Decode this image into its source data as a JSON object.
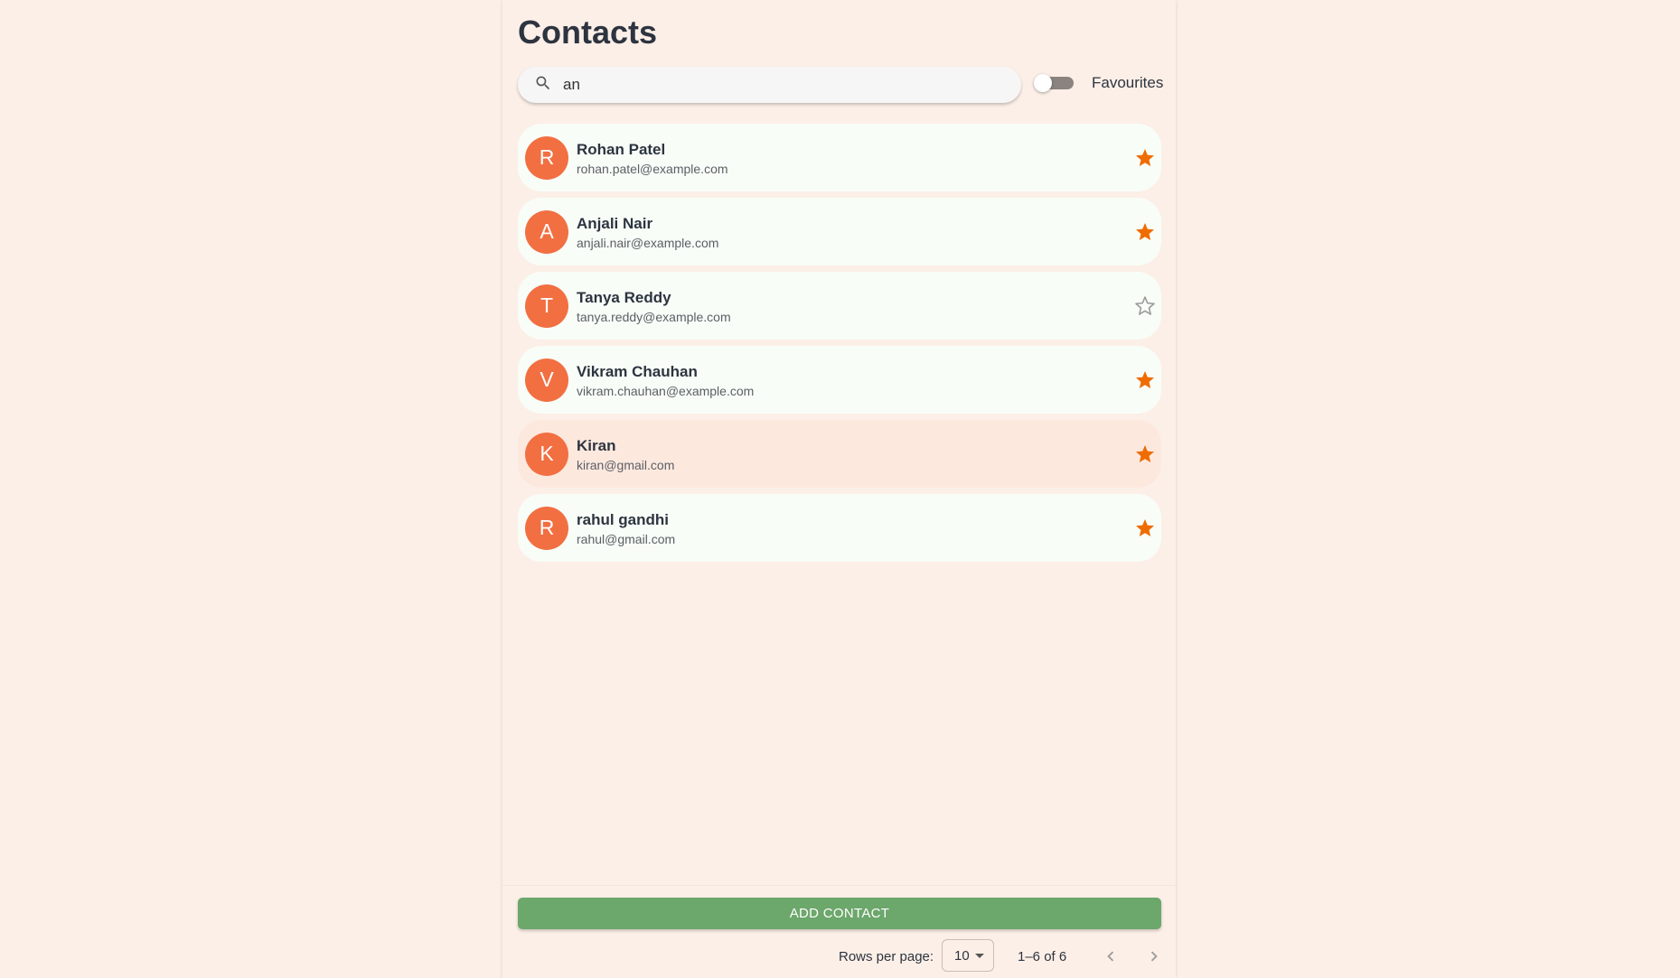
{
  "page": {
    "title": "Contacts"
  },
  "search": {
    "value": "an",
    "icon": "search-icon"
  },
  "favourites_toggle": {
    "label": "Favourites",
    "on": false
  },
  "contacts": [
    {
      "initial": "R",
      "name": "Rohan Patel",
      "email": "rohan.patel@example.com",
      "favourite": true
    },
    {
      "initial": "A",
      "name": "Anjali Nair",
      "email": "anjali.nair@example.com",
      "favourite": true
    },
    {
      "initial": "T",
      "name": "Tanya Reddy",
      "email": "tanya.reddy@example.com",
      "favourite": false
    },
    {
      "initial": "V",
      "name": "Vikram Chauhan",
      "email": "vikram.chauhan@example.com",
      "favourite": true
    },
    {
      "initial": "K",
      "name": "Kiran",
      "email": "kiran@gmail.com",
      "favourite": true
    },
    {
      "initial": "R",
      "name": "rahul gandhi",
      "email": "rahul@gmail.com",
      "favourite": true
    }
  ],
  "add_button": {
    "label": "ADD CONTACT"
  },
  "pagination": {
    "rows_per_page_label": "Rows per page:",
    "rows_per_page_value": "10",
    "range": "1–6 of 6"
  },
  "colors": {
    "background": "#fcefe7",
    "avatar": "#f26f42",
    "star_filled": "#ef6c00",
    "star_outline": "#9a9a9a",
    "add_button": "#6ca76b",
    "card": "#f8fdf7",
    "card_hover": "#fde8de"
  }
}
